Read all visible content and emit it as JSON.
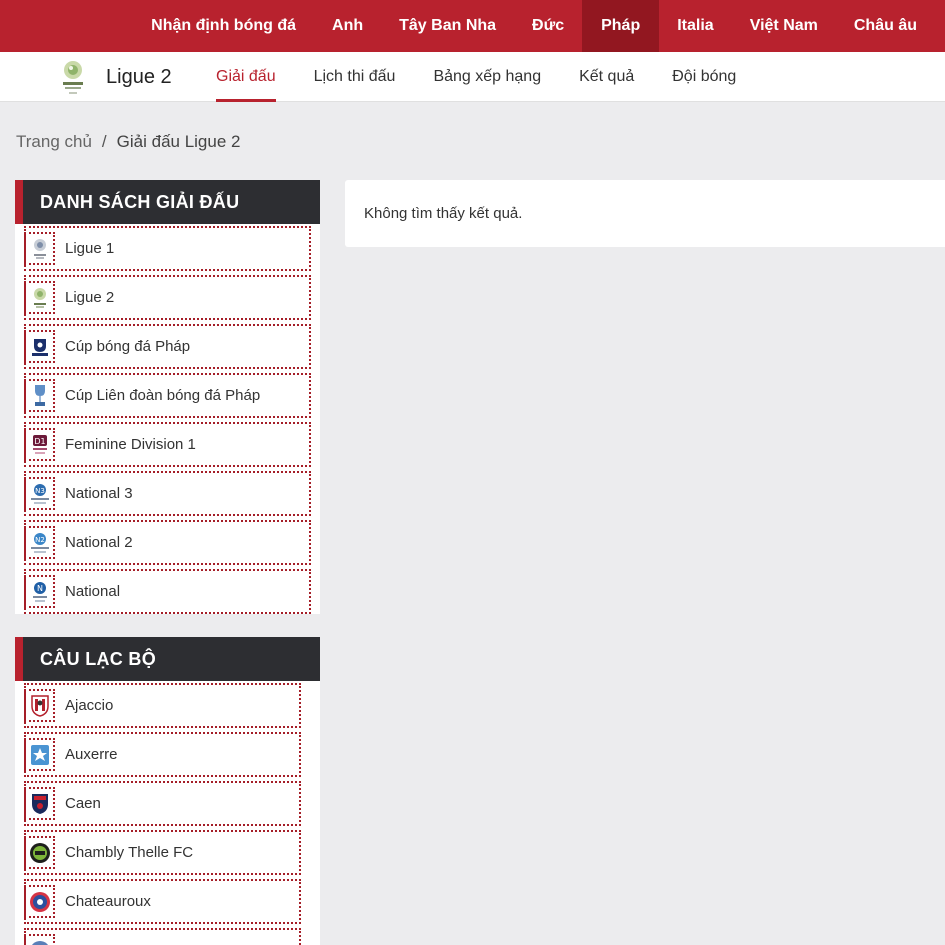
{
  "topnav": {
    "items": [
      "Nhận định bóng đá",
      "Anh",
      "Tây Ban Nha",
      "Đức",
      "Pháp",
      "Italia",
      "Việt Nam",
      "Châu âu"
    ],
    "active_index": 4,
    "bg_color": "#b8222e",
    "active_color": "#921720"
  },
  "league": {
    "name": "Ligue 2",
    "logo_icon": "ligue2-logo"
  },
  "subnav": {
    "tabs": [
      "Giải đấu",
      "Lịch thi đấu",
      "Bảng xếp hạng",
      "Kết quả",
      "Đội bóng"
    ],
    "active_index": 0
  },
  "breadcrumb": {
    "home": "Trang chủ",
    "separator": "/",
    "current": "Giải đấu Ligue 2"
  },
  "leagues_panel": {
    "title": "DANH SÁCH GIẢI ĐẤU",
    "items": [
      {
        "label": "Ligue 1",
        "icon": "ligue1-logo-icon"
      },
      {
        "label": "Ligue 2",
        "icon": "ligue2-logo-icon"
      },
      {
        "label": "Cúp bóng đá Pháp",
        "icon": "coupe-de-france-logo-icon"
      },
      {
        "label": "Cúp Liên đoàn bóng đá Pháp",
        "icon": "coupe-de-la-ligue-trophy-icon"
      },
      {
        "label": "Feminine Division 1",
        "icon": "d1-feminine-logo-icon"
      },
      {
        "label": "National 3",
        "icon": "national3-logo-icon"
      },
      {
        "label": "National 2",
        "icon": "national2-logo-icon"
      },
      {
        "label": "National",
        "icon": "national-logo-icon"
      }
    ]
  },
  "clubs_panel": {
    "title": "CÂU LẠC BỘ",
    "items": [
      {
        "label": "Ajaccio",
        "icon": "ajaccio-crest-icon"
      },
      {
        "label": "Auxerre",
        "icon": "auxerre-crest-icon"
      },
      {
        "label": "Caen",
        "icon": "caen-crest-icon"
      },
      {
        "label": "Chambly Thelle FC",
        "icon": "chambly-crest-icon"
      },
      {
        "label": "Chateauroux",
        "icon": "chateauroux-crest-icon"
      }
    ]
  },
  "result": {
    "message": "Không tìm thấy kết quả."
  }
}
